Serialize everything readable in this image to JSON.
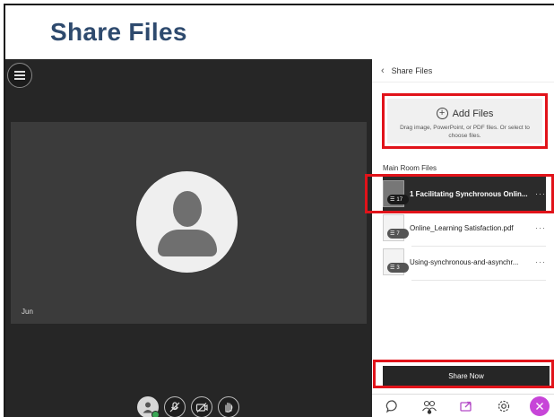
{
  "slide": {
    "title": "Share Files"
  },
  "video": {
    "participant_name": "Jun",
    "controls": [
      "user-icon",
      "mic-off-icon",
      "camera-off-icon",
      "hand-raise-icon"
    ]
  },
  "panel": {
    "header": "Share Files",
    "add_files": {
      "title": "Add Files",
      "description": "Drag image, PowerPoint, or PDF files. Or select to choose files."
    },
    "section_label": "Main Room Files",
    "files": [
      {
        "name": "1 Facilitating Synchronous Onlin...",
        "badge": "17",
        "active": true
      },
      {
        "name": "Online_Learning Satisfaction.pdf",
        "badge": "7",
        "active": false
      },
      {
        "name": "Using-synchronous-and-asynchr...",
        "badge": "3",
        "active": false
      }
    ],
    "share_button": "Share Now",
    "bottom_nav": [
      "chat-icon",
      "participants-icon",
      "share-content-icon",
      "settings-icon",
      "close-icon"
    ]
  },
  "colors": {
    "highlight": "#e1131a",
    "title": "#2e4a6e",
    "accent": "#c745d8"
  }
}
